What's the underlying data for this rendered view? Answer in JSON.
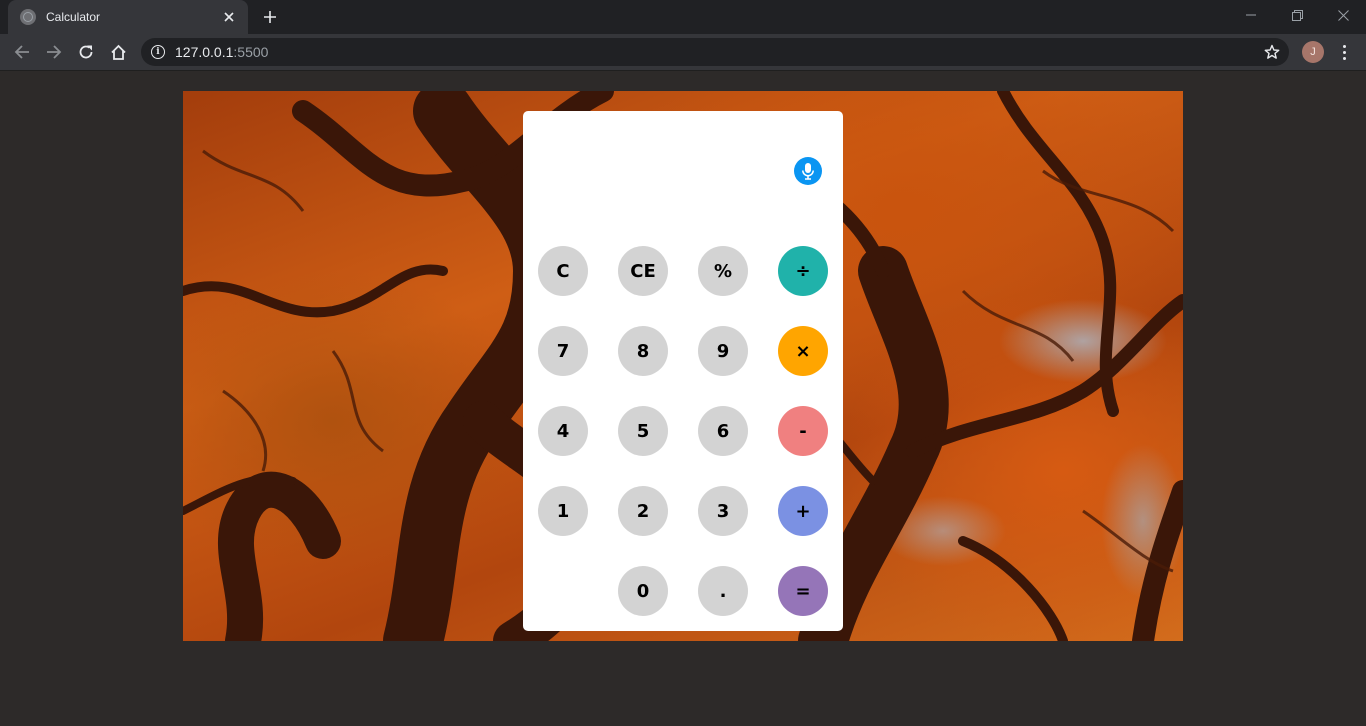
{
  "browser": {
    "tab_title": "Calculator",
    "url_host": "127.0.0.1",
    "url_port": ":5500",
    "profile_initial": "J"
  },
  "calculator": {
    "display": "",
    "keys": {
      "clear": "C",
      "clear_entry": "CE",
      "percent": "%",
      "divide": "÷",
      "seven": "7",
      "eight": "8",
      "nine": "9",
      "multiply": "×",
      "four": "4",
      "five": "5",
      "six": "6",
      "subtract": "-",
      "one": "1",
      "two": "2",
      "three": "3",
      "add": "+",
      "zero": "0",
      "decimal": ".",
      "equals": "="
    },
    "colors": {
      "number_key": "#d3d3d3",
      "divide": "#20b2aa",
      "multiply": "#ffa500",
      "subtract": "#f08080",
      "add": "#7b91e3",
      "equals": "#9575b8",
      "mic": "#0a95f2"
    }
  },
  "icons": {
    "mic": "microphone-icon",
    "back": "arrow-left-icon",
    "forward": "arrow-right-icon",
    "reload": "reload-icon",
    "home": "home-icon",
    "info": "info-icon",
    "bookmark": "star-icon",
    "menu": "kebab-menu-icon"
  }
}
